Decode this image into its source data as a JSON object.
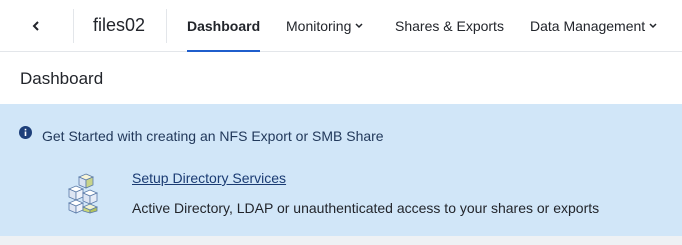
{
  "app": {
    "title": "files02"
  },
  "nav": {
    "back_icon": "chevron-left-icon",
    "items": [
      {
        "label": "Dashboard",
        "active": true,
        "has_dropdown": false
      },
      {
        "label": "Monitoring",
        "active": false,
        "has_dropdown": true
      },
      {
        "label": "Shares & Exports",
        "active": false,
        "has_dropdown": false
      },
      {
        "label": "Data Management",
        "active": false,
        "has_dropdown": true
      }
    ]
  },
  "page": {
    "title": "Dashboard"
  },
  "banner": {
    "icon": "info-icon",
    "heading": "Get Started with creating an NFS Export or SMB Share",
    "item": {
      "icon": "directory-stack-icon",
      "link_label": "Setup Directory Services",
      "description": "Active Directory, LDAP or unauthenticated access to your shares or exports"
    }
  },
  "colors": {
    "accent": "#1f5ecc",
    "banner_bg": "#d1e6f8",
    "link": "#1a3b73",
    "info_icon": "#1d3f7a"
  }
}
